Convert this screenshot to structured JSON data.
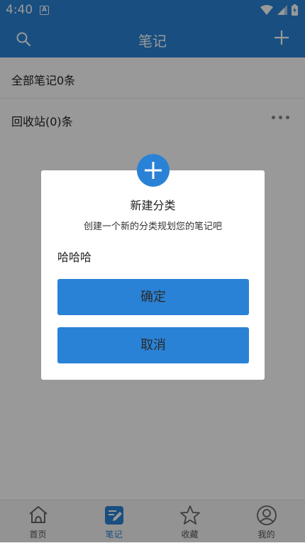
{
  "status": {
    "time": "4:40",
    "badge": "A"
  },
  "appbar": {
    "title": "笔记"
  },
  "list": {
    "all_notes": "全部笔记0条",
    "recycle_bin": "回收站(0)条"
  },
  "dialog": {
    "title": "新建分类",
    "subtitle": "创建一个新的分类规划您的笔记吧",
    "input_value": "哈哈哈",
    "confirm_label": "确定",
    "cancel_label": "取消"
  },
  "tabs": [
    {
      "label": "首页",
      "icon": "home-icon"
    },
    {
      "label": "笔记",
      "icon": "note-edit-icon"
    },
    {
      "label": "收藏",
      "icon": "star-icon"
    },
    {
      "label": "我的",
      "icon": "profile-icon"
    }
  ],
  "colors": {
    "primary": "#2a82d6",
    "overlay": "rgba(0,0,0,0.4)"
  }
}
